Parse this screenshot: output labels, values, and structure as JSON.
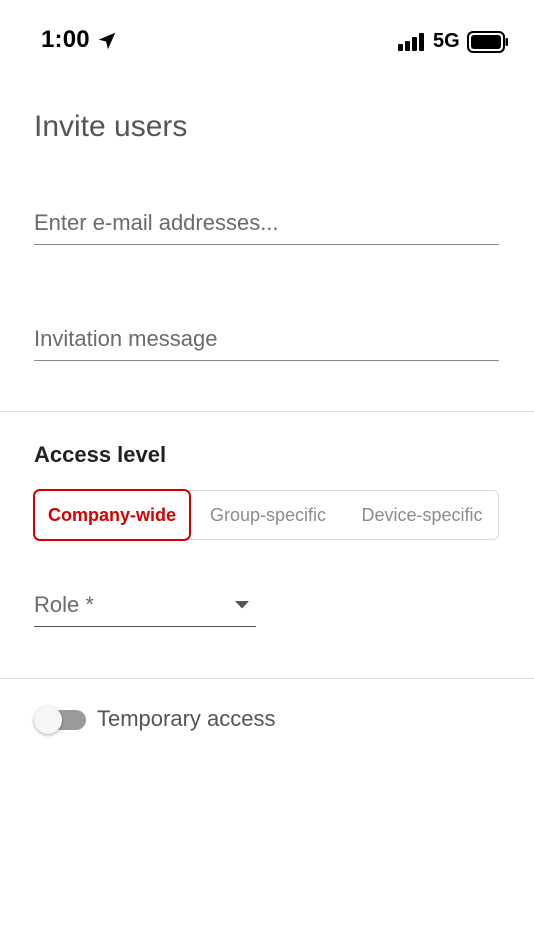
{
  "status_bar": {
    "time": "1:00",
    "network": "5G",
    "icons": [
      "location-arrow-icon",
      "signal-bars-icon",
      "battery-icon"
    ]
  },
  "page": {
    "title": "Invite users"
  },
  "form": {
    "email": {
      "value": "",
      "placeholder": "Enter e-mail addresses..."
    },
    "message": {
      "value": "",
      "placeholder": "Invitation message"
    },
    "access_level": {
      "heading": "Access level",
      "options": [
        "Company-wide",
        "Group-specific",
        "Device-specific"
      ],
      "selected": "Company-wide"
    },
    "role": {
      "label": "Role *",
      "icon": "dropdown-arrow-icon"
    },
    "temporary_access": {
      "label": "Temporary access",
      "enabled": false
    }
  },
  "colors": {
    "accent": "#d60000",
    "title": "#555555",
    "muted": "#8c8c8c"
  }
}
